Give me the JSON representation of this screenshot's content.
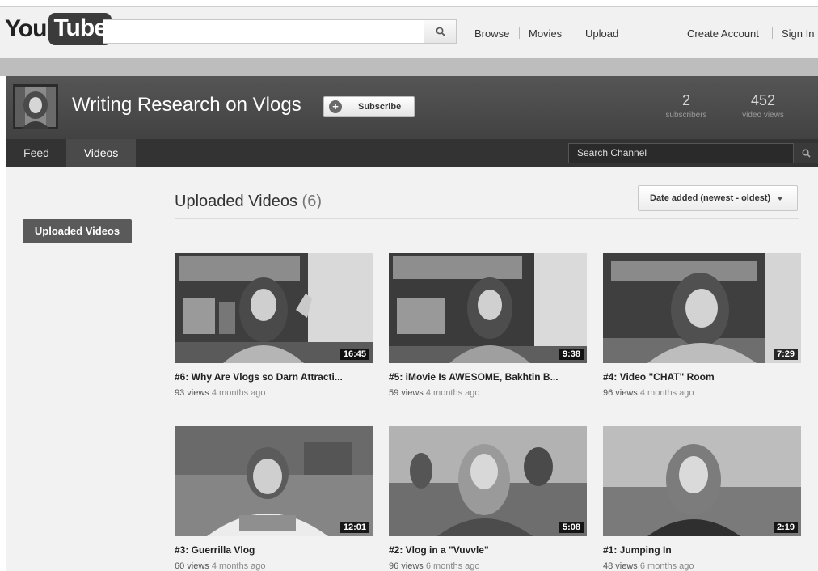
{
  "masthead": {
    "logo_you": "You",
    "logo_tube": "Tube",
    "search_placeholder": "",
    "nav": [
      "Browse",
      "Movies",
      "Upload"
    ],
    "create_account": "Create Account",
    "sign_in": "Sign In"
  },
  "channel": {
    "title": "Writing Research on Vlogs",
    "subscribe_label": "Subscribe",
    "stats": [
      {
        "value": "2",
        "label": "subscribers"
      },
      {
        "value": "452",
        "label": "video views"
      }
    ],
    "tabs": [
      "Feed",
      "Videos"
    ],
    "search_channel_placeholder": "Search Channel"
  },
  "sidebar": {
    "uploaded_button": "Uploaded Videos"
  },
  "section": {
    "title": "Uploaded Videos",
    "count": "(6)",
    "sort_label": "Date added (newest - oldest)"
  },
  "videos": [
    {
      "title": "#6: Why Are Vlogs so Darn Attracti...",
      "views": "93 views",
      "age": "4 months ago",
      "duration": "16:45"
    },
    {
      "title": "#5: iMovie Is AWESOME, Bakhtin B...",
      "views": "59 views",
      "age": "4 months ago",
      "duration": "9:38"
    },
    {
      "title": "#4: Video \"CHAT\" Room",
      "views": "96 views",
      "age": "4 months ago",
      "duration": "7:29"
    },
    {
      "title": "#3: Guerrilla Vlog",
      "views": "60 views",
      "age": "4 months ago",
      "duration": "12:01"
    },
    {
      "title": "#2: Vlog in a \"Vuvvle\"",
      "views": "96 views",
      "age": "6 months ago",
      "duration": "5:08"
    },
    {
      "title": "#1: Jumping In",
      "views": "48 views",
      "age": "6 months ago",
      "duration": "2:19"
    }
  ]
}
